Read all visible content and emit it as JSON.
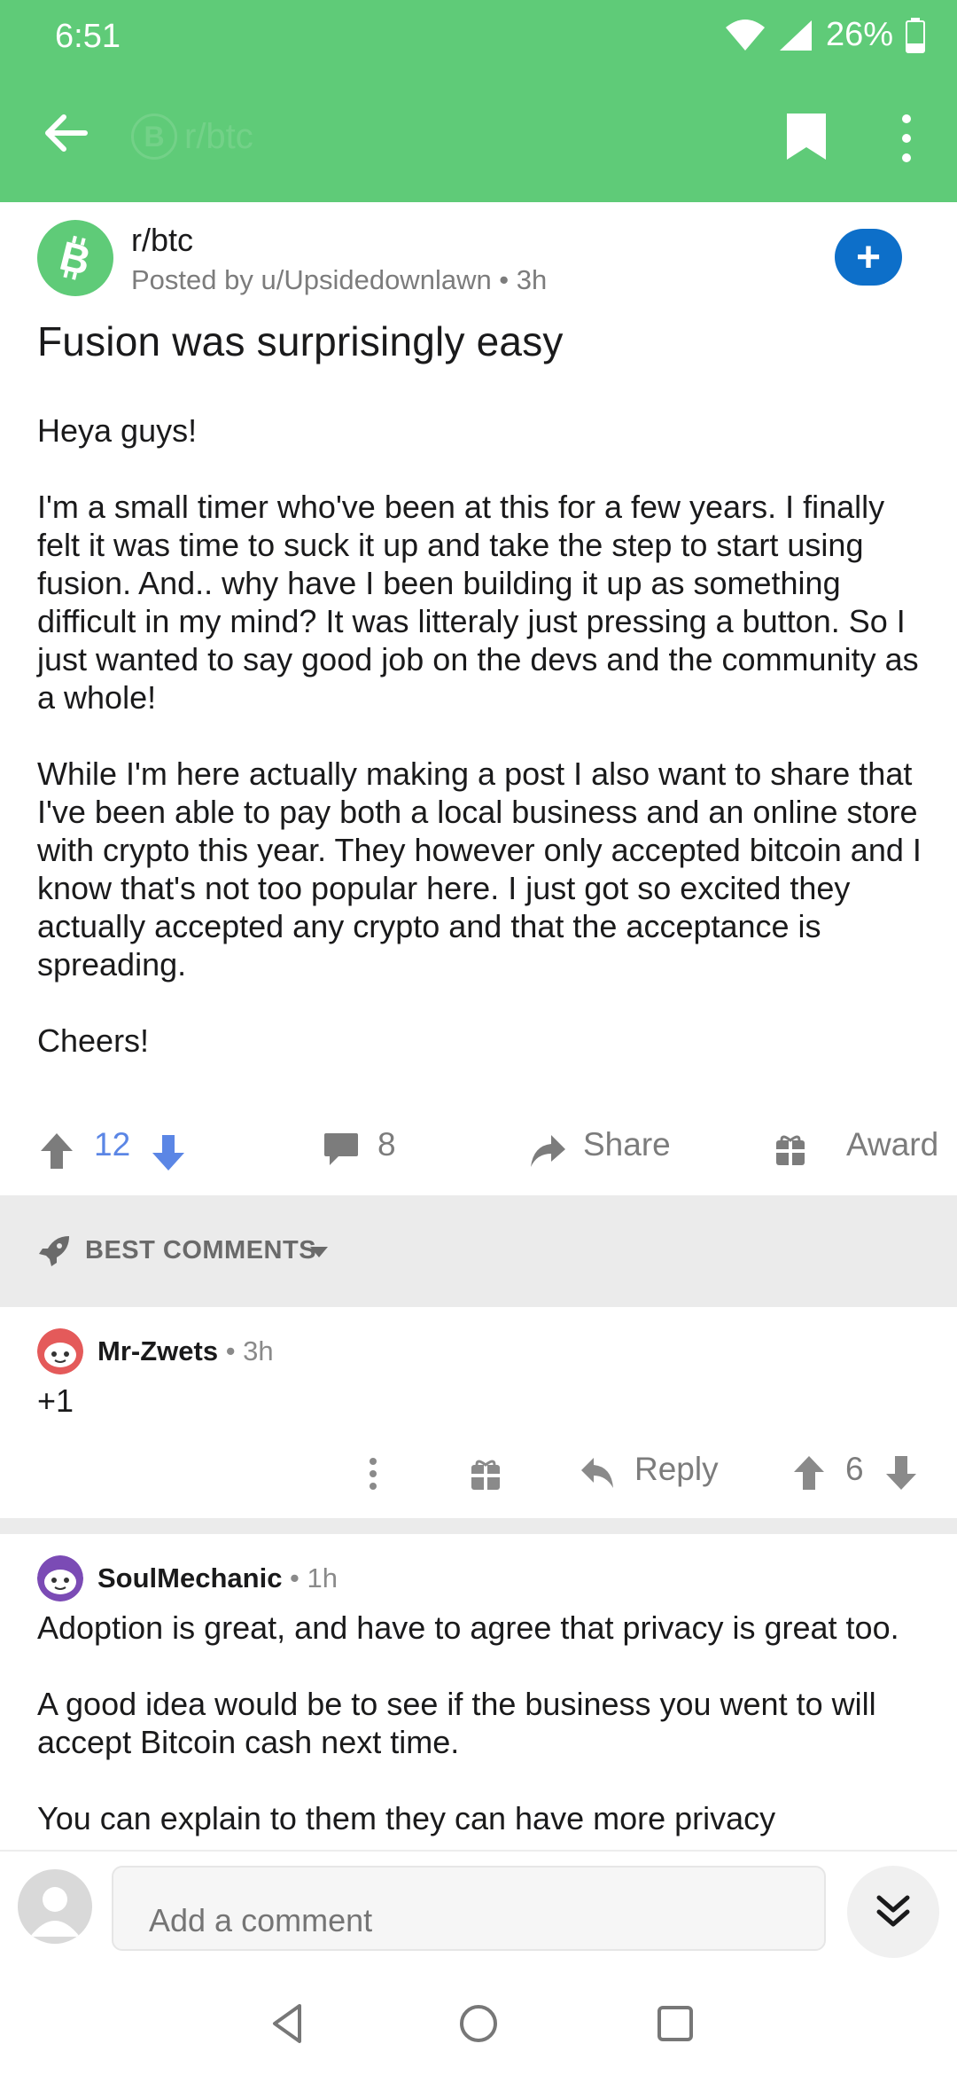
{
  "status": {
    "time": "6:51",
    "battery": "26%"
  },
  "appbar": {
    "subreddit_ghost": "r/btc",
    "subreddit_ghost_logo": "B"
  },
  "post": {
    "subreddit": "r/btc",
    "meta": "Posted by u/Upsidedownlawn • 3h",
    "title": "Fusion was surprisingly easy",
    "join_label": "+",
    "paragraphs": [
      "Heya guys!",
      "I'm a small timer who've been at this for a few years. I finally felt it was time to suck it up and take the step to start using fusion. And.. why have I been building it up as something difficult in my mind? It was litteraly just pressing a button. So I just wanted to say good job on the devs and the community as a whole!",
      "While I'm here actually making a post I also want to share that I've been able to pay both a local business and an online store with crypto this year. They however only accepted bitcoin and I know that's not too popular here. I just got so excited they actually accepted any crypto and that the acceptance is spreading.",
      "Cheers!"
    ],
    "votes": "12",
    "comments_count": "8",
    "share_label": "Share",
    "award_label": "Award"
  },
  "sort": {
    "label": "BEST COMMENTS"
  },
  "comments": [
    {
      "author": "Mr-Zwets",
      "time": " • 3h",
      "body": "+1",
      "reply_label": "Reply",
      "votes": "6"
    },
    {
      "author": "SoulMechanic",
      "time": " • 1h",
      "paragraphs": [
        "Adoption is great, and have to agree that privacy is great too.",
        "A good idea would be to see if the business you went to will accept Bitcoin cash next time.",
        "You can explain to them they can have more privacy"
      ]
    }
  ],
  "composer": {
    "placeholder": "Add a comment"
  },
  "colors": {
    "header": "#5fcb78",
    "accent_blue": "#0d6fc9",
    "vote_blue": "#5b86e5"
  }
}
